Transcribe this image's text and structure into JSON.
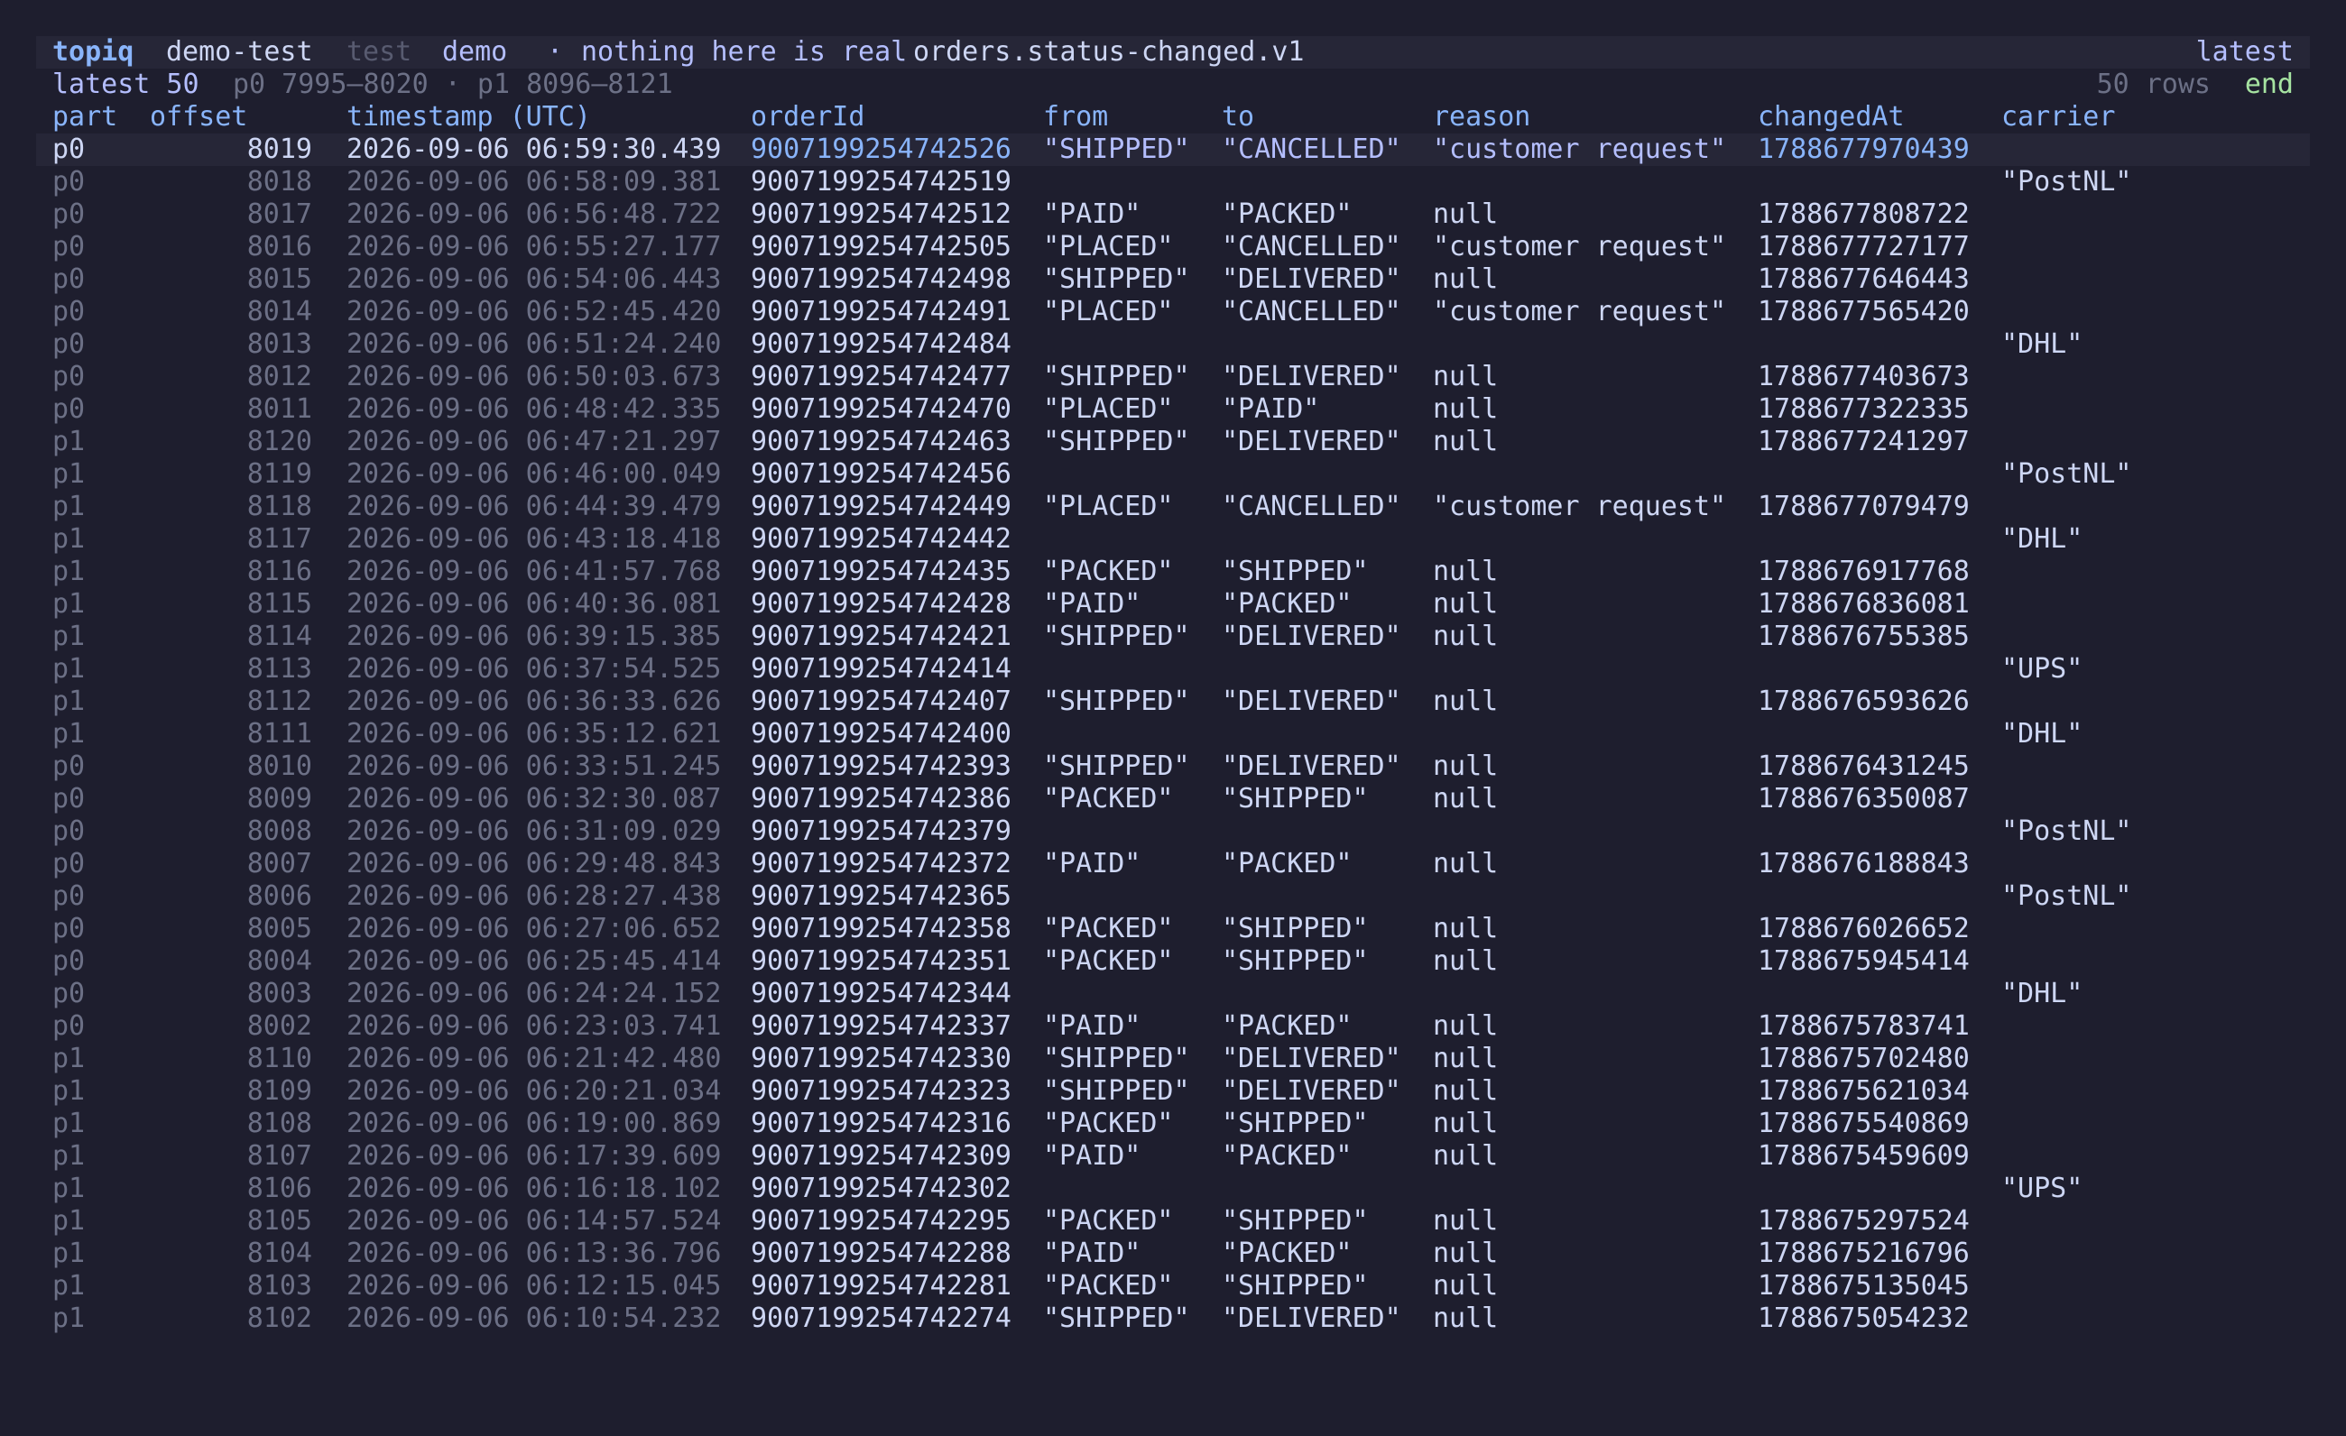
{
  "titlebar": {
    "brand": "topiq",
    "context": "demo-test",
    "env": "test",
    "demo_label": "demo",
    "separator": "·",
    "demo_note": "nothing here is real",
    "topic": "orders.status-changed.v1",
    "mode": "latest"
  },
  "statusbar": {
    "window": "latest 50",
    "ranges": "p0 7995–8020 · p1 8096–8121",
    "row_count": "50 rows",
    "position": "end"
  },
  "columns": {
    "part": "part",
    "offset": "offset",
    "timestamp": "timestamp (UTC)",
    "orderId": "orderId",
    "from": "from",
    "to": "to",
    "reason": "reason",
    "changedAt": "changedAt",
    "carrier": "carrier"
  },
  "selected_row": 0,
  "rows": [
    {
      "part": "p0",
      "offset": "8019",
      "timestamp": "2026-09-06 06:59:30.439",
      "orderId": "9007199254742526",
      "from": "\"SHIPPED\"",
      "to": "\"CANCELLED\"",
      "reason": "\"customer request\"",
      "changedAt": "1788677970439",
      "carrier": ""
    },
    {
      "part": "p0",
      "offset": "8018",
      "timestamp": "2026-09-06 06:58:09.381",
      "orderId": "9007199254742519",
      "from": "",
      "to": "",
      "reason": "",
      "changedAt": "",
      "carrier": "\"PostNL\""
    },
    {
      "part": "p0",
      "offset": "8017",
      "timestamp": "2026-09-06 06:56:48.722",
      "orderId": "9007199254742512",
      "from": "\"PAID\"",
      "to": "\"PACKED\"",
      "reason": "null",
      "changedAt": "1788677808722",
      "carrier": ""
    },
    {
      "part": "p0",
      "offset": "8016",
      "timestamp": "2026-09-06 06:55:27.177",
      "orderId": "9007199254742505",
      "from": "\"PLACED\"",
      "to": "\"CANCELLED\"",
      "reason": "\"customer request\"",
      "changedAt": "1788677727177",
      "carrier": ""
    },
    {
      "part": "p0",
      "offset": "8015",
      "timestamp": "2026-09-06 06:54:06.443",
      "orderId": "9007199254742498",
      "from": "\"SHIPPED\"",
      "to": "\"DELIVERED\"",
      "reason": "null",
      "changedAt": "1788677646443",
      "carrier": ""
    },
    {
      "part": "p0",
      "offset": "8014",
      "timestamp": "2026-09-06 06:52:45.420",
      "orderId": "9007199254742491",
      "from": "\"PLACED\"",
      "to": "\"CANCELLED\"",
      "reason": "\"customer request\"",
      "changedAt": "1788677565420",
      "carrier": ""
    },
    {
      "part": "p0",
      "offset": "8013",
      "timestamp": "2026-09-06 06:51:24.240",
      "orderId": "9007199254742484",
      "from": "",
      "to": "",
      "reason": "",
      "changedAt": "",
      "carrier": "\"DHL\""
    },
    {
      "part": "p0",
      "offset": "8012",
      "timestamp": "2026-09-06 06:50:03.673",
      "orderId": "9007199254742477",
      "from": "\"SHIPPED\"",
      "to": "\"DELIVERED\"",
      "reason": "null",
      "changedAt": "1788677403673",
      "carrier": ""
    },
    {
      "part": "p0",
      "offset": "8011",
      "timestamp": "2026-09-06 06:48:42.335",
      "orderId": "9007199254742470",
      "from": "\"PLACED\"",
      "to": "\"PAID\"",
      "reason": "null",
      "changedAt": "1788677322335",
      "carrier": ""
    },
    {
      "part": "p1",
      "offset": "8120",
      "timestamp": "2026-09-06 06:47:21.297",
      "orderId": "9007199254742463",
      "from": "\"SHIPPED\"",
      "to": "\"DELIVERED\"",
      "reason": "null",
      "changedAt": "1788677241297",
      "carrier": ""
    },
    {
      "part": "p1",
      "offset": "8119",
      "timestamp": "2026-09-06 06:46:00.049",
      "orderId": "9007199254742456",
      "from": "",
      "to": "",
      "reason": "",
      "changedAt": "",
      "carrier": "\"PostNL\""
    },
    {
      "part": "p1",
      "offset": "8118",
      "timestamp": "2026-09-06 06:44:39.479",
      "orderId": "9007199254742449",
      "from": "\"PLACED\"",
      "to": "\"CANCELLED\"",
      "reason": "\"customer request\"",
      "changedAt": "1788677079479",
      "carrier": ""
    },
    {
      "part": "p1",
      "offset": "8117",
      "timestamp": "2026-09-06 06:43:18.418",
      "orderId": "9007199254742442",
      "from": "",
      "to": "",
      "reason": "",
      "changedAt": "",
      "carrier": "\"DHL\""
    },
    {
      "part": "p1",
      "offset": "8116",
      "timestamp": "2026-09-06 06:41:57.768",
      "orderId": "9007199254742435",
      "from": "\"PACKED\"",
      "to": "\"SHIPPED\"",
      "reason": "null",
      "changedAt": "1788676917768",
      "carrier": ""
    },
    {
      "part": "p1",
      "offset": "8115",
      "timestamp": "2026-09-06 06:40:36.081",
      "orderId": "9007199254742428",
      "from": "\"PAID\"",
      "to": "\"PACKED\"",
      "reason": "null",
      "changedAt": "1788676836081",
      "carrier": ""
    },
    {
      "part": "p1",
      "offset": "8114",
      "timestamp": "2026-09-06 06:39:15.385",
      "orderId": "9007199254742421",
      "from": "\"SHIPPED\"",
      "to": "\"DELIVERED\"",
      "reason": "null",
      "changedAt": "1788676755385",
      "carrier": ""
    },
    {
      "part": "p1",
      "offset": "8113",
      "timestamp": "2026-09-06 06:37:54.525",
      "orderId": "9007199254742414",
      "from": "",
      "to": "",
      "reason": "",
      "changedAt": "",
      "carrier": "\"UPS\""
    },
    {
      "part": "p1",
      "offset": "8112",
      "timestamp": "2026-09-06 06:36:33.626",
      "orderId": "9007199254742407",
      "from": "\"SHIPPED\"",
      "to": "\"DELIVERED\"",
      "reason": "null",
      "changedAt": "1788676593626",
      "carrier": ""
    },
    {
      "part": "p1",
      "offset": "8111",
      "timestamp": "2026-09-06 06:35:12.621",
      "orderId": "9007199254742400",
      "from": "",
      "to": "",
      "reason": "",
      "changedAt": "",
      "carrier": "\"DHL\""
    },
    {
      "part": "p0",
      "offset": "8010",
      "timestamp": "2026-09-06 06:33:51.245",
      "orderId": "9007199254742393",
      "from": "\"SHIPPED\"",
      "to": "\"DELIVERED\"",
      "reason": "null",
      "changedAt": "1788676431245",
      "carrier": ""
    },
    {
      "part": "p0",
      "offset": "8009",
      "timestamp": "2026-09-06 06:32:30.087",
      "orderId": "9007199254742386",
      "from": "\"PACKED\"",
      "to": "\"SHIPPED\"",
      "reason": "null",
      "changedAt": "1788676350087",
      "carrier": ""
    },
    {
      "part": "p0",
      "offset": "8008",
      "timestamp": "2026-09-06 06:31:09.029",
      "orderId": "9007199254742379",
      "from": "",
      "to": "",
      "reason": "",
      "changedAt": "",
      "carrier": "\"PostNL\""
    },
    {
      "part": "p0",
      "offset": "8007",
      "timestamp": "2026-09-06 06:29:48.843",
      "orderId": "9007199254742372",
      "from": "\"PAID\"",
      "to": "\"PACKED\"",
      "reason": "null",
      "changedAt": "1788676188843",
      "carrier": ""
    },
    {
      "part": "p0",
      "offset": "8006",
      "timestamp": "2026-09-06 06:28:27.438",
      "orderId": "9007199254742365",
      "from": "",
      "to": "",
      "reason": "",
      "changedAt": "",
      "carrier": "\"PostNL\""
    },
    {
      "part": "p0",
      "offset": "8005",
      "timestamp": "2026-09-06 06:27:06.652",
      "orderId": "9007199254742358",
      "from": "\"PACKED\"",
      "to": "\"SHIPPED\"",
      "reason": "null",
      "changedAt": "1788676026652",
      "carrier": ""
    },
    {
      "part": "p0",
      "offset": "8004",
      "timestamp": "2026-09-06 06:25:45.414",
      "orderId": "9007199254742351",
      "from": "\"PACKED\"",
      "to": "\"SHIPPED\"",
      "reason": "null",
      "changedAt": "1788675945414",
      "carrier": ""
    },
    {
      "part": "p0",
      "offset": "8003",
      "timestamp": "2026-09-06 06:24:24.152",
      "orderId": "9007199254742344",
      "from": "",
      "to": "",
      "reason": "",
      "changedAt": "",
      "carrier": "\"DHL\""
    },
    {
      "part": "p0",
      "offset": "8002",
      "timestamp": "2026-09-06 06:23:03.741",
      "orderId": "9007199254742337",
      "from": "\"PAID\"",
      "to": "\"PACKED\"",
      "reason": "null",
      "changedAt": "1788675783741",
      "carrier": ""
    },
    {
      "part": "p1",
      "offset": "8110",
      "timestamp": "2026-09-06 06:21:42.480",
      "orderId": "9007199254742330",
      "from": "\"SHIPPED\"",
      "to": "\"DELIVERED\"",
      "reason": "null",
      "changedAt": "1788675702480",
      "carrier": ""
    },
    {
      "part": "p1",
      "offset": "8109",
      "timestamp": "2026-09-06 06:20:21.034",
      "orderId": "9007199254742323",
      "from": "\"SHIPPED\"",
      "to": "\"DELIVERED\"",
      "reason": "null",
      "changedAt": "1788675621034",
      "carrier": ""
    },
    {
      "part": "p1",
      "offset": "8108",
      "timestamp": "2026-09-06 06:19:00.869",
      "orderId": "9007199254742316",
      "from": "\"PACKED\"",
      "to": "\"SHIPPED\"",
      "reason": "null",
      "changedAt": "1788675540869",
      "carrier": ""
    },
    {
      "part": "p1",
      "offset": "8107",
      "timestamp": "2026-09-06 06:17:39.609",
      "orderId": "9007199254742309",
      "from": "\"PAID\"",
      "to": "\"PACKED\"",
      "reason": "null",
      "changedAt": "1788675459609",
      "carrier": ""
    },
    {
      "part": "p1",
      "offset": "8106",
      "timestamp": "2026-09-06 06:16:18.102",
      "orderId": "9007199254742302",
      "from": "",
      "to": "",
      "reason": "",
      "changedAt": "",
      "carrier": "\"UPS\""
    },
    {
      "part": "p1",
      "offset": "8105",
      "timestamp": "2026-09-06 06:14:57.524",
      "orderId": "9007199254742295",
      "from": "\"PACKED\"",
      "to": "\"SHIPPED\"",
      "reason": "null",
      "changedAt": "1788675297524",
      "carrier": ""
    },
    {
      "part": "p1",
      "offset": "8104",
      "timestamp": "2026-09-06 06:13:36.796",
      "orderId": "9007199254742288",
      "from": "\"PAID\"",
      "to": "\"PACKED\"",
      "reason": "null",
      "changedAt": "1788675216796",
      "carrier": ""
    },
    {
      "part": "p1",
      "offset": "8103",
      "timestamp": "2026-09-06 06:12:15.045",
      "orderId": "9007199254742281",
      "from": "\"PACKED\"",
      "to": "\"SHIPPED\"",
      "reason": "null",
      "changedAt": "1788675135045",
      "carrier": ""
    },
    {
      "part": "p1",
      "offset": "8102",
      "timestamp": "2026-09-06 06:10:54.232",
      "orderId": "9007199254742274",
      "from": "\"SHIPPED\"",
      "to": "\"DELIVERED\"",
      "reason": "null",
      "changedAt": "1788675054232",
      "carrier": ""
    }
  ]
}
